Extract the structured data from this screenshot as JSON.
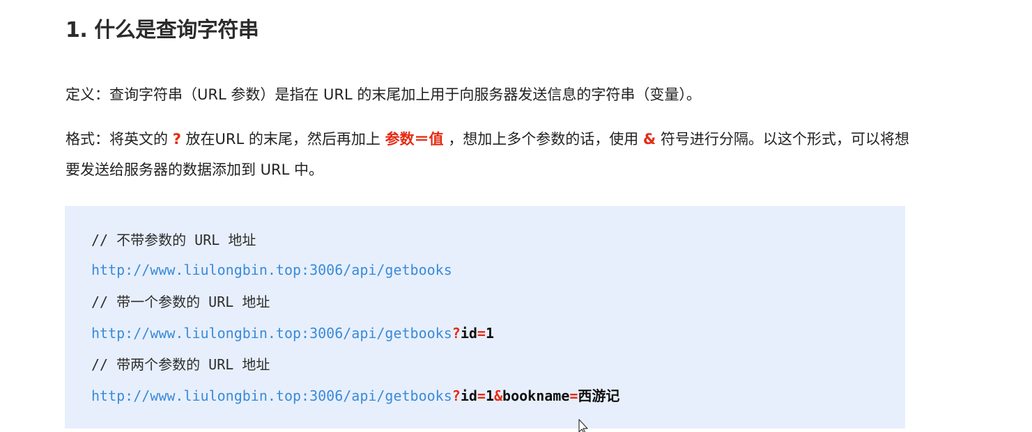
{
  "section": {
    "heading": "1. 什么是查询字符串"
  },
  "definition": {
    "text": "定义：查询字符串（URL 参数）是指在 URL 的末尾加上用于向服务器发送信息的字符串（变量）。"
  },
  "format": {
    "part1": "格式：将英文的 ",
    "q": "?",
    "part2": " 放在URL 的末尾，然后再加上 ",
    "param_eq": "参数＝值",
    "part3": " ，想加上多个参数的话，使用 ",
    "amp": "&",
    "part4": " 符号进行分隔。以这个形式，可以将想要发送给服务器的数据添加到 URL 中。"
  },
  "code": {
    "comment1": "// 不带参数的 URL 地址",
    "url1": "http://www.liulongbin.top:3006/api/getbooks",
    "comment2": "// 带一个参数的 URL 地址",
    "url2_base": "http://www.liulongbin.top:3006/api/getbooks",
    "url2_q": "?",
    "url2_k1": "id",
    "url2_eq1": "=",
    "url2_v1": "1",
    "comment3": "// 带两个参数的 URL 地址",
    "url3_base": "http://www.liulongbin.top:3006/api/getbooks",
    "url3_q": "?",
    "url3_k1": "id",
    "url3_eq1": "=",
    "url3_v1": "1",
    "url3_amp": "&",
    "url3_k2": "bookname",
    "url3_eq2": "=",
    "url3_v2": "西游记"
  },
  "colors": {
    "code_bg": "#e7effc",
    "url": "#3a8bd8",
    "highlight": "#e52b12"
  },
  "icons": {
    "cursor": "mouse-pointer-icon"
  }
}
